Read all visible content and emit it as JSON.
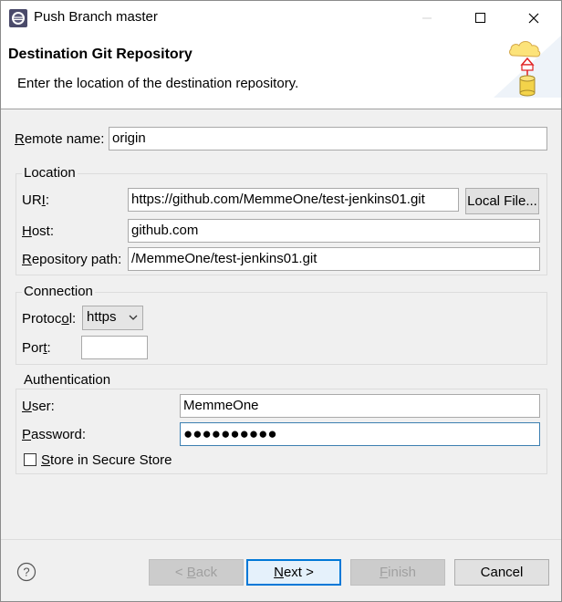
{
  "window": {
    "title": "Push Branch master"
  },
  "banner": {
    "title": "Destination Git Repository",
    "description": "Enter the location of the destination repository."
  },
  "remote": {
    "label_prefix": "R",
    "label_rest": "emote name:",
    "value": "origin"
  },
  "location": {
    "title": "Location",
    "uri_label_a": "UR",
    "uri_label_b": "I",
    "uri_label_c": ":",
    "uri_value": "https://github.com/MemmeOne/test-jenkins01.git",
    "local_file_label": "Local File...",
    "host_label_a": "H",
    "host_label_b": "ost:",
    "host_value": "github.com",
    "repo_label_a": "R",
    "repo_label_b": "epository path:",
    "repo_value": "/MemmeOne/test-jenkins01.git"
  },
  "connection": {
    "title": "Connection",
    "protocol_label_a": "Protoc",
    "protocol_label_b": "o",
    "protocol_label_c": "l:",
    "protocol_value": "https",
    "port_label_a": "Por",
    "port_label_b": "t",
    "port_label_c": ":",
    "port_value": ""
  },
  "authentication": {
    "title": "Authentication",
    "user_label_a": "U",
    "user_label_b": "ser:",
    "user_value": "MemmeOne",
    "password_label_a": "P",
    "password_label_b": "assword:",
    "password_value": "●●●●●●●●●●",
    "store_label_a": "S",
    "store_label_b": "tore in Secure Store",
    "store_checked": false
  },
  "footer": {
    "back_a": "< ",
    "back_b": "B",
    "back_c": "ack",
    "next_a": "N",
    "next_b": "ext >",
    "finish_a": "F",
    "finish_b": "inish",
    "cancel": "Cancel"
  },
  "icons": {
    "app": "eclipse-icon",
    "banner": "cloud-push-database-icon",
    "help": "help-icon"
  },
  "colors": {
    "focus_border": "#3c7fb1",
    "default_button": "#0078d7"
  }
}
